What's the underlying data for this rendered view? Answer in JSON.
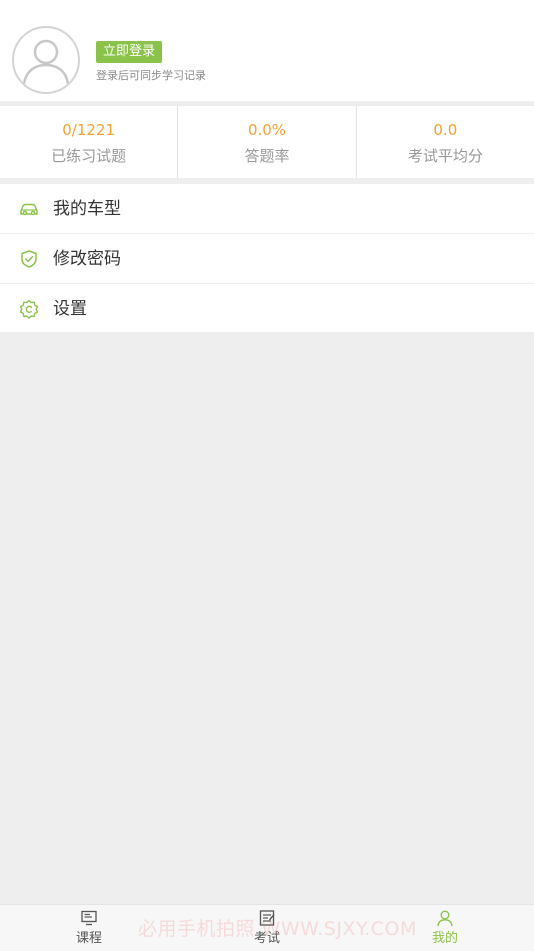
{
  "profile": {
    "login_label": "立即登录",
    "login_hint": "登录后可同步学习记录"
  },
  "stats": [
    {
      "value": "0/1221",
      "label": "已练习试题"
    },
    {
      "value": "0.0%",
      "label": "答题率"
    },
    {
      "value": "0.0",
      "label": "考试平均分"
    }
  ],
  "menu": [
    {
      "label": "我的车型",
      "icon": "car-icon"
    },
    {
      "label": "修改密码",
      "icon": "shield-check-icon"
    },
    {
      "label": "设置",
      "icon": "gear-icon"
    }
  ],
  "tabs": [
    {
      "label": "课程",
      "icon": "course-icon",
      "active": false
    },
    {
      "label": "考试",
      "icon": "exam-icon",
      "active": false
    },
    {
      "label": "我的",
      "icon": "user-icon",
      "active": true
    }
  ],
  "watermark": "必用手机拍照 WWW.SJXY.COM",
  "colors": {
    "accent": "#8bc34a",
    "stat_value": "#f5a034",
    "background": "#eeeeee"
  }
}
